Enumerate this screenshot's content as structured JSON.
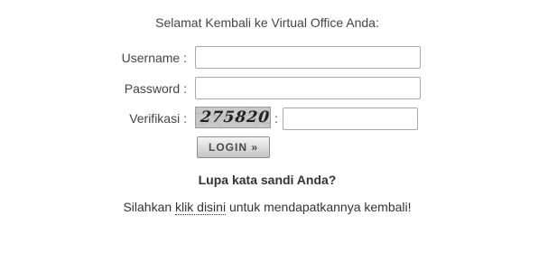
{
  "welcome": "Selamat Kembali ke Virtual Office Anda:",
  "form": {
    "username_label": "Username :",
    "username_value": "",
    "password_label": "Password :",
    "password_value": "",
    "verify_label": "Verifikasi :",
    "captcha_text": "275820",
    "verify_colon": ":",
    "verify_value": "",
    "login_label": "LOGIN »"
  },
  "forgot": {
    "heading": "Lupa kata sandi Anda?",
    "text_before": "Silahkan ",
    "link": "klik disini",
    "text_after": " untuk mendapatkannya kembali!"
  }
}
